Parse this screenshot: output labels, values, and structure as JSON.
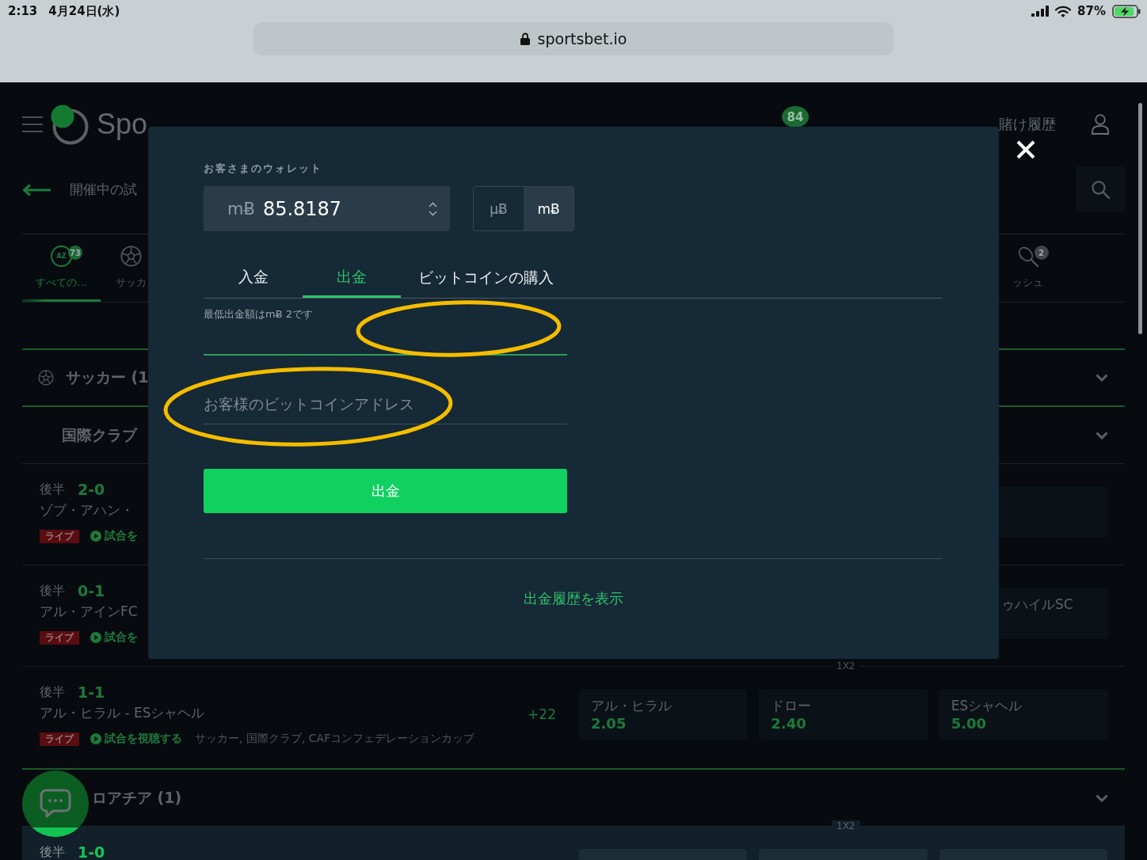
{
  "status_bar": {
    "time": "2:13",
    "date": "4月24日(水)",
    "battery": "87%"
  },
  "browser": {
    "address": "sportsbet.io"
  },
  "site_header": {
    "logo": "Spo",
    "notifications": "84",
    "bet_history": "賭け履歴"
  },
  "breadcrumb": {
    "label": "開催中の試"
  },
  "sport_tabs": [
    {
      "kind": "az",
      "icon_text": "AZ",
      "badge": "73",
      "label": "すべての...",
      "selected": true
    },
    {
      "kind": "soccer",
      "label": "サッカ",
      "selected": false
    },
    {
      "kind": "racket",
      "badge": "2",
      "label": "ッシュ",
      "selected": false
    }
  ],
  "sections": [
    {
      "title": "サッカー (1",
      "competition": "国際クラブ",
      "matches": [
        {
          "period": "後半",
          "score": "2-0",
          "teams": "ゾブ・アハン・",
          "live": "ライブ",
          "watch": "試合を",
          "odds": [
            {
              "selected": false
            }
          ]
        },
        {
          "period": "後半",
          "score": "0-1",
          "teams": "アル・アインFC",
          "live": "ライブ",
          "watch": "試合を",
          "odds": [
            {
              "team": "ゥハイルSC",
              "selected": false
            }
          ]
        },
        {
          "market": "1X2",
          "period": "後半",
          "score": "1-1",
          "teams": "アル・ヒラル - ESシャヘル",
          "live": "ライブ",
          "watch": "試合を視聴する",
          "tags": "サッカー, 国際クラブ, CAFコンフェデレーションカップ",
          "more": "+22",
          "odds": [
            {
              "team": "アル・ヒラル",
              "price": "2.05",
              "selected": false
            },
            {
              "team": "ドロー",
              "price": "2.40",
              "selected": false
            },
            {
              "team": "ESシャヘル",
              "price": "5.00",
              "selected": false
            }
          ]
        }
      ]
    },
    {
      "title": "ロアチア (1)",
      "matches": [
        {
          "market": "1X2",
          "period": "後半",
          "score": "1-0",
          "odds": [
            {
              "selected": false
            },
            {
              "selected": false
            },
            {
              "selected": false
            }
          ]
        }
      ]
    }
  ],
  "wallet_dialog": {
    "wallet_label": "お客さまのウォレット",
    "currency": "mɃ",
    "balance": "85.8187",
    "units": [
      {
        "label": "µɃ",
        "selected": false
      },
      {
        "label": "mɃ",
        "selected": true
      }
    ],
    "tabs": [
      {
        "label": "入金",
        "selected": false
      },
      {
        "label": "出金",
        "selected": true
      },
      {
        "label": "ビットコインの購入",
        "selected": false
      }
    ],
    "minimum_note": "最低出金額はmɃ 2です",
    "amount_field": {
      "focused": true,
      "highlighted": true
    },
    "address_field": {
      "placeholder": "お客様のビットコインアドレス",
      "focused": false,
      "highlighted": true
    },
    "submit_button": "出金",
    "history_link": "出金履歴を表示"
  }
}
